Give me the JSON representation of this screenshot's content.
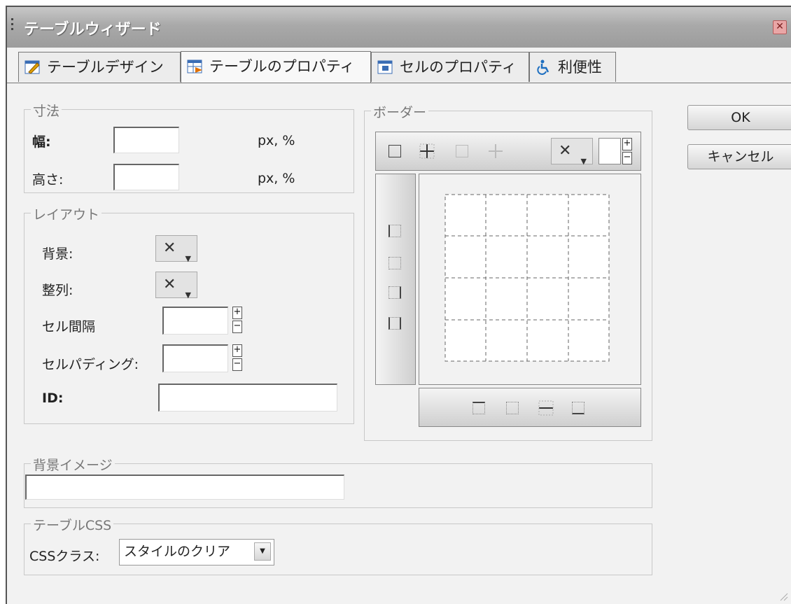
{
  "window": {
    "title": "テーブルウィザード"
  },
  "tabs": [
    {
      "label": "テーブルデザイン"
    },
    {
      "label": "テーブルのプロパティ"
    },
    {
      "label": "セルのプロパティ"
    },
    {
      "label": "利便性"
    }
  ],
  "dimensions": {
    "legend": "寸法",
    "width_label": "幅:",
    "width_value": "",
    "width_unit": "px, %",
    "height_label": "高さ:",
    "height_value": "",
    "height_unit": "px, %"
  },
  "layout": {
    "legend": "レイアウト",
    "background_label": "背景:",
    "align_label": "整列:",
    "dropdown_value": "✕",
    "cell_spacing_label": "セル間隔",
    "cell_spacing_value": "",
    "cell_padding_label": "セルパディング:",
    "cell_padding_value": "",
    "id_label": "ID:",
    "id_value": ""
  },
  "border": {
    "legend": "ボーダー",
    "color_value": "✕"
  },
  "buttons": {
    "ok": "OK",
    "cancel": "キャンセル"
  },
  "background_image": {
    "legend": "背景イメージ",
    "value": ""
  },
  "table_css": {
    "legend": "テーブルCSS",
    "class_label": "CSSクラス:",
    "class_value": "スタイルのクリア"
  },
  "spinner": {
    "plus": "+",
    "minus": "−"
  }
}
